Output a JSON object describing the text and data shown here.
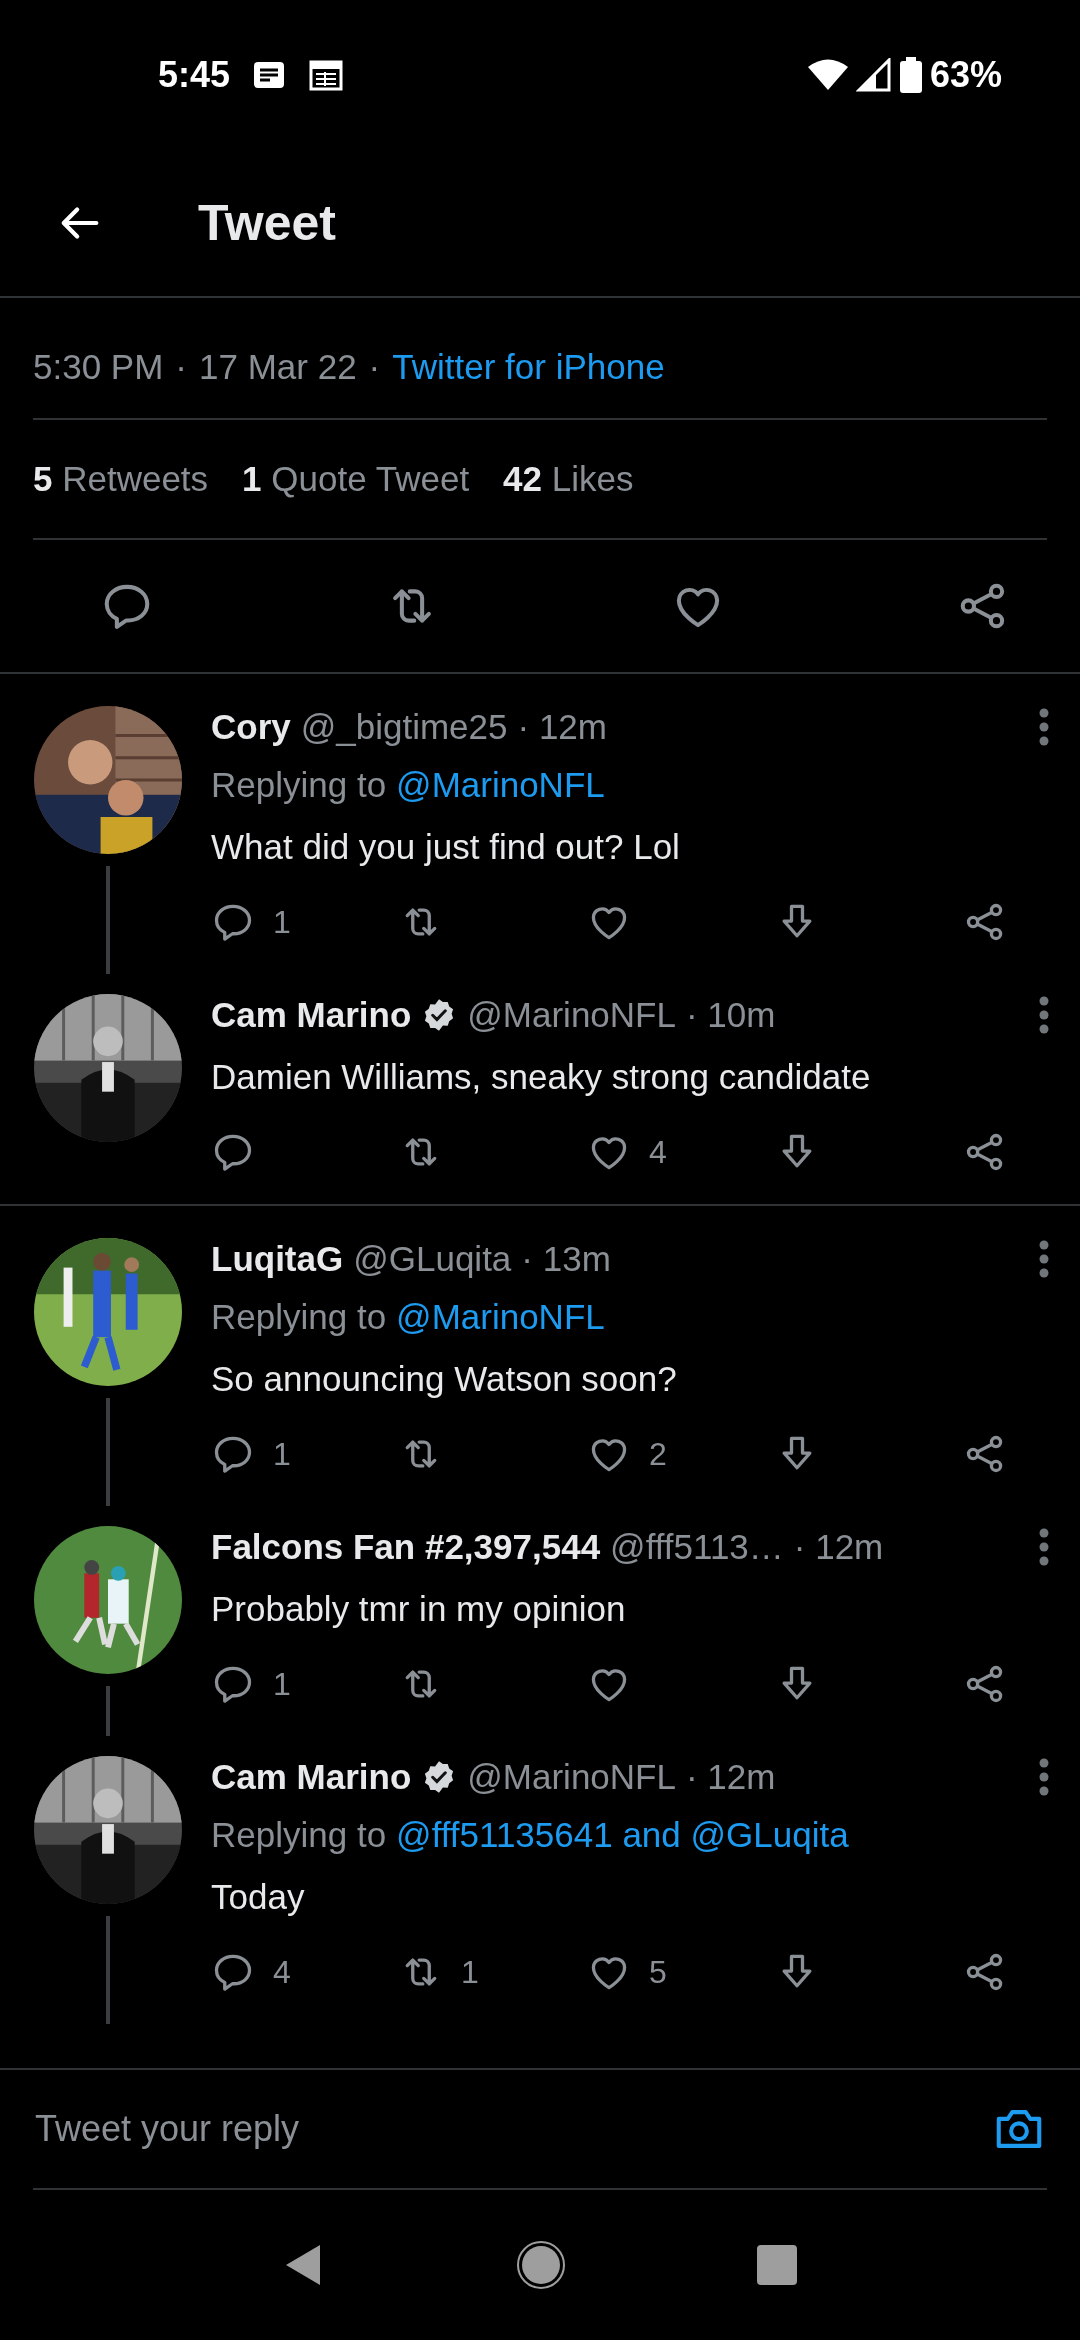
{
  "status_bar": {
    "time": "5:45",
    "battery": "63%"
  },
  "header": {
    "title": "Tweet"
  },
  "tweet": {
    "meta": [
      {
        "kind": "text",
        "text": "5:30 PM"
      },
      {
        "kind": "text",
        "text": "·"
      },
      {
        "kind": "text",
        "text": "17 Mar 22"
      },
      {
        "kind": "text",
        "text": "·"
      },
      {
        "kind": "link",
        "text": "Twitter for iPhone"
      }
    ],
    "stats": [
      {
        "text": "**5** Retweets"
      },
      {
        "text": "**1** Quote Tweet"
      },
      {
        "text": "**42** Likes"
      }
    ],
    "actions": [
      {
        "kind": "reply"
      },
      {
        "kind": "retweet"
      },
      {
        "kind": "like"
      },
      {
        "kind": "share"
      }
    ]
  },
  "conversations": [
    [
      {
        "name": "Cory",
        "verified": false,
        "handle": "@_bigtime25",
        "time": "· 12m",
        "replying_label": "Replying to",
        "replying_to": "@MarinoNFL",
        "text": "What did you just find out? Lol",
        "connector": true,
        "actions": [
          {
            "kind": "reply",
            "count": "1"
          },
          {
            "kind": "retweet"
          },
          {
            "kind": "like"
          },
          {
            "kind": "download"
          },
          {
            "kind": "share"
          }
        ]
      },
      {
        "name": "Cam Marino",
        "verified": true,
        "handle": "@MarinoNFL",
        "time": "· 10m",
        "text": "Damien Williams, sneaky strong candidate",
        "connector": false,
        "actions": [
          {
            "kind": "reply"
          },
          {
            "kind": "retweet"
          },
          {
            "kind": "like",
            "count": "4"
          },
          {
            "kind": "download"
          },
          {
            "kind": "share"
          }
        ]
      }
    ],
    [
      {
        "name": "LuqitaG",
        "verified": false,
        "handle": "@GLuqita",
        "time": "· 13m",
        "replying_label": "Replying to",
        "replying_to": "@MarinoNFL",
        "text": "So announcing Watson soon?",
        "connector": true,
        "actions": [
          {
            "kind": "reply",
            "count": "1"
          },
          {
            "kind": "retweet"
          },
          {
            "kind": "like",
            "count": "2"
          },
          {
            "kind": "download"
          },
          {
            "kind": "share"
          }
        ]
      },
      {
        "name": "Falcons Fan #2,397,544",
        "verified": false,
        "handle": "@fff5113…",
        "time": "· 12m",
        "text": "Probably tmr in my opinion",
        "connector": true,
        "actions": [
          {
            "kind": "reply",
            "count": "1"
          },
          {
            "kind": "retweet"
          },
          {
            "kind": "like"
          },
          {
            "kind": "download"
          },
          {
            "kind": "share"
          }
        ]
      },
      {
        "name": "Cam Marino",
        "verified": true,
        "handle": "@MarinoNFL",
        "time": "· 12m",
        "replying_label": "Replying to",
        "replying_to": "@fff51135641 and @GLuqita",
        "text": "Today",
        "connector": true,
        "actions": [
          {
            "kind": "reply",
            "count": "4"
          },
          {
            "kind": "retweet",
            "count": "1"
          },
          {
            "kind": "like",
            "count": "5"
          },
          {
            "kind": "download"
          },
          {
            "kind": "share"
          }
        ]
      }
    ]
  ],
  "composer": {
    "placeholder": "Tweet your reply"
  }
}
